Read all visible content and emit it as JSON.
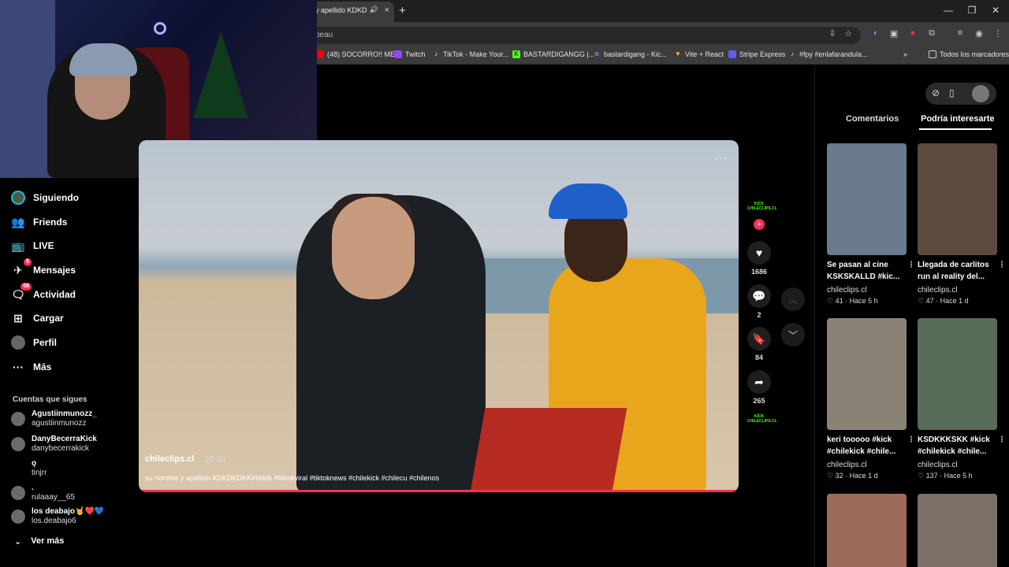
{
  "browser": {
    "tab_title": "y apellido KDKD",
    "tab_close": "×",
    "new_tab": "+",
    "address_text": "peau",
    "bookmarks": [
      {
        "label": "(48) SOCORRO!! ME...",
        "icon": "youtube-icon",
        "color": "#ff0000"
      },
      {
        "label": "Twitch",
        "icon": "twitch-icon",
        "color": "#9146ff"
      },
      {
        "label": "TikTok - Make Your...",
        "icon": "tiktok-icon",
        "color": "#ffffff"
      },
      {
        "label": "BASTARDIGANGG |...",
        "icon": "kick-icon",
        "color": "#53fc18"
      },
      {
        "label": "bastardigang - Kic...",
        "icon": "link-icon",
        "color": "#7aa7ff"
      },
      {
        "label": "Vite + React",
        "icon": "vite-icon",
        "color": "#bd34fe"
      },
      {
        "label": "Stripe Express",
        "icon": "stripe-icon",
        "color": "#635bff"
      },
      {
        "label": "#fpy #enlafarandula...",
        "icon": "tiktok-icon",
        "color": "#ffffff"
      }
    ],
    "all_bookmarks": "Todos los marcadores"
  },
  "nav": {
    "items": [
      {
        "label": "Siguiendo",
        "icon": "avatar-icon"
      },
      {
        "label": "Friends",
        "icon": "friends-icon"
      },
      {
        "label": "LIVE",
        "icon": "live-icon"
      },
      {
        "label": "Mensajes",
        "icon": "messages-icon",
        "badge": "5"
      },
      {
        "label": "Actividad",
        "icon": "activity-icon",
        "badge": "68"
      },
      {
        "label": "Cargar",
        "icon": "upload-icon"
      },
      {
        "label": "Perfil",
        "icon": "profile-icon"
      },
      {
        "label": "Más",
        "icon": "more-icon"
      }
    ],
    "following_title": "Cuentas que sigues",
    "accounts": [
      {
        "name": "Agustiinmunozz_",
        "handle": "agustiinmunozz"
      },
      {
        "name": "DanyBecerraKick",
        "handle": "danybecerrakick"
      },
      {
        "name": "ǫ",
        "handle": "tinjrr"
      },
      {
        "name": ".",
        "handle": "rulaaay__65"
      },
      {
        "name": "los deabajo🤘❤️💙",
        "handle": "los.deabajo6"
      }
    ],
    "see_more": "Ver más"
  },
  "video": {
    "author": "chileclips.cl",
    "date": "· 12-20",
    "caption": "su nombre y apellido KDKDKDKK#tiktok #tiktokviral #tiktoknews #chilekick #chilecu #chilenos",
    "more": "···",
    "likes": "1686",
    "comments": "2",
    "saves": "84",
    "shares": "265",
    "kick_tag": "KICK",
    "kick_sub": "CHILECLIPS.CL"
  },
  "panel": {
    "tab_comments": "Comentarios",
    "tab_related": "Podría interesarte",
    "related": [
      {
        "title1": "Se pasan al cine",
        "title2": "KSKSKALLD #kic...",
        "author": "chileclips.cl",
        "likes": "41",
        "time": "Hace 5 h",
        "color": "#6a7a8f"
      },
      {
        "title1": "Llegada de carlitos",
        "title2": "run al reality del...",
        "author": "chileclips.cl",
        "likes": "47",
        "time": "Hace 1 d",
        "color": "#5d4a3f"
      },
      {
        "title1": "keri tooooo #kick",
        "title2": "#chilekick #chile...",
        "author": "chileclips.cl",
        "likes": "32",
        "time": "Hace 1 d",
        "color": "#8b8276"
      },
      {
        "title1": "KSDKKKSKK #kick",
        "title2": "#chilekick #chile...",
        "author": "chileclips.cl",
        "likes": "137",
        "time": "Hace 5 h",
        "color": "#566b58"
      },
      {
        "color": "#9e6a5c"
      },
      {
        "color": "#7b7068"
      }
    ]
  }
}
